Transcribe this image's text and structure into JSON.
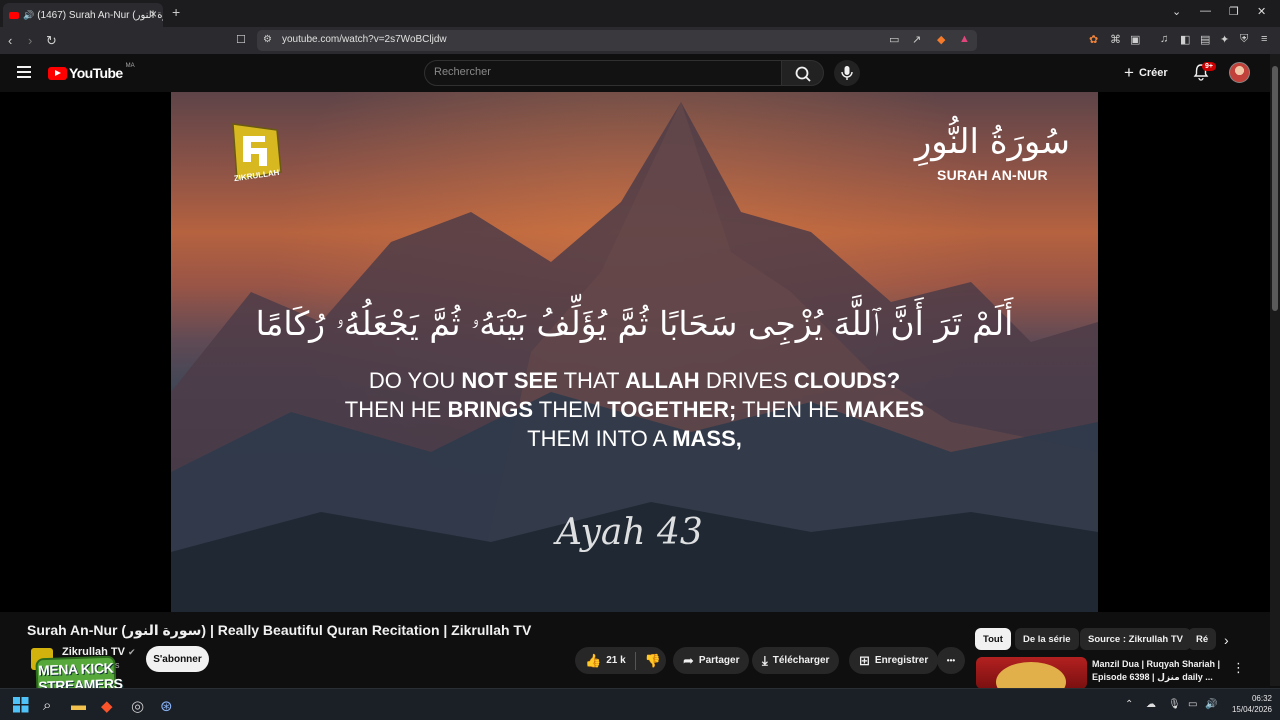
{
  "browser": {
    "tab_title": "(1467) Surah An-Nur (سورة النور)",
    "new_tab": "+",
    "url": "youtube.com/watch?v=2s7WoBCljdw",
    "window_controls": [
      "⌄",
      "—",
      "❐",
      "✕"
    ]
  },
  "header": {
    "logo_text": "YouTube",
    "country_code": "MA",
    "search_placeholder": "Rechercher",
    "create_label": "Créer",
    "notif_badge": "9+"
  },
  "video": {
    "channel_logo_text": "ZIKRULLAH",
    "surah_arabic": "سُورَةُ النُّورِ",
    "surah_english": "SURAH AN-NUR",
    "ayah_arabic": "أَلَمْ تَرَ أَنَّ ٱللَّهَ يُزْجِى سَحَابًا ثُمَّ يُؤَلِّفُ بَيْنَهُۥ ثُمَّ يَجْعَلُهُۥ رُكَامًا",
    "translation": {
      "l1": [
        "DO YOU ",
        "NOT SEE",
        " THAT ",
        "ALLAH",
        " DRIVES ",
        "CLOUDS?"
      ],
      "l2": [
        "THEN HE ",
        "BRINGS",
        " THEM ",
        "TOGETHER;",
        " THEN HE ",
        "MAKES"
      ],
      "l3": [
        "THEM INTO A ",
        "MASS,"
      ]
    },
    "ayah_label": "Ayah 43"
  },
  "below": {
    "title": "Surah An-Nur (سورة النور) | Really Beautiful Quran Recitation | Zikrullah TV",
    "channel_name": "Zikrullah TV",
    "verified_icon": "✔",
    "subs": "és",
    "subscribe_label": "S'abonner",
    "sticker_text": "MENA KICK STREAMERS",
    "likes": "21 k",
    "share_label": "Partager",
    "download_label": "Télécharger",
    "save_label": "Enregistrer",
    "more": "•••"
  },
  "sidebar": {
    "chips": [
      "Tout",
      "De la série",
      "Source : Zikrullah TV",
      "Ré"
    ],
    "rec_title": "Manzil Dua | Ruqyah Shariah | Episode 6398 | منزل daily ..."
  },
  "taskbar": {
    "time": "06:32",
    "date": "15/04/2026"
  }
}
